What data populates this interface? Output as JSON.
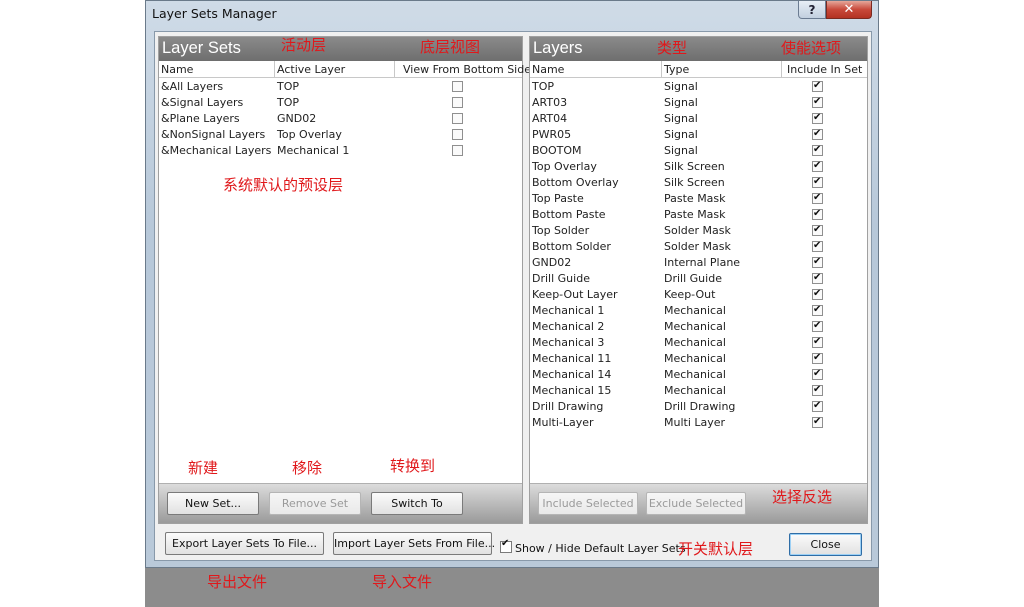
{
  "window": {
    "title": "Layer Sets Manager",
    "help": "?",
    "close": "✕"
  },
  "left": {
    "title": "Layer Sets",
    "columns": [
      "Name",
      "Active Layer",
      "View From Bottom Side"
    ],
    "rows": [
      {
        "name": "&All Layers",
        "active": "TOP",
        "bottom": false
      },
      {
        "name": "&Signal Layers",
        "active": "TOP",
        "bottom": false
      },
      {
        "name": "&Plane Layers",
        "active": "GND02",
        "bottom": false
      },
      {
        "name": "&NonSignal Layers",
        "active": "Top Overlay",
        "bottom": false
      },
      {
        "name": "&Mechanical Layers",
        "active": "Mechanical 1",
        "bottom": false
      }
    ],
    "buttons": {
      "new_set": "New Set...",
      "remove_set": "Remove Set",
      "switch_to": "Switch To"
    }
  },
  "right": {
    "title": "Layers",
    "columns": [
      "Name",
      "Type",
      "Include In Set"
    ],
    "rows": [
      {
        "name": "TOP",
        "type": "Signal",
        "include": true
      },
      {
        "name": "ART03",
        "type": "Signal",
        "include": true
      },
      {
        "name": "ART04",
        "type": "Signal",
        "include": true
      },
      {
        "name": "PWR05",
        "type": "Signal",
        "include": true
      },
      {
        "name": "BOOTOM",
        "type": "Signal",
        "include": true
      },
      {
        "name": "Top Overlay",
        "type": "Silk Screen",
        "include": true
      },
      {
        "name": "Bottom Overlay",
        "type": "Silk Screen",
        "include": true
      },
      {
        "name": "Top Paste",
        "type": "Paste Mask",
        "include": true
      },
      {
        "name": "Bottom Paste",
        "type": "Paste Mask",
        "include": true
      },
      {
        "name": "Top Solder",
        "type": "Solder Mask",
        "include": true
      },
      {
        "name": "Bottom Solder",
        "type": "Solder Mask",
        "include": true
      },
      {
        "name": "GND02",
        "type": "Internal Plane",
        "include": true
      },
      {
        "name": "Drill Guide",
        "type": "Drill Guide",
        "include": true
      },
      {
        "name": "Keep-Out Layer",
        "type": "Keep-Out",
        "include": true
      },
      {
        "name": "Mechanical 1",
        "type": "Mechanical",
        "include": true
      },
      {
        "name": "Mechanical 2",
        "type": "Mechanical",
        "include": true
      },
      {
        "name": "Mechanical 3",
        "type": "Mechanical",
        "include": true
      },
      {
        "name": "Mechanical 11",
        "type": "Mechanical",
        "include": true
      },
      {
        "name": "Mechanical 14",
        "type": "Mechanical",
        "include": true
      },
      {
        "name": "Mechanical 15",
        "type": "Mechanical",
        "include": true
      },
      {
        "name": "Drill Drawing",
        "type": "Drill Drawing",
        "include": true
      },
      {
        "name": "Multi-Layer",
        "type": "Multi Layer",
        "include": true
      }
    ],
    "buttons": {
      "include_selected": "Include Selected",
      "exclude_selected": "Exclude Selected"
    }
  },
  "bottom": {
    "export": "Export Layer Sets To File...",
    "import": "Import Layer Sets From File...",
    "show_hide": "Show / Hide Default Layer Sets",
    "show_hide_checked": true,
    "close": "Close"
  },
  "annotations": {
    "active_layer": "活动层",
    "bottom_view": "底层视图",
    "type": "类型",
    "enable_option": "使能选项",
    "default_sets": "系统默认的预设层",
    "new": "新建",
    "remove": "移除",
    "switch": "转换到",
    "invert_select": "选择反选",
    "toggle_default": "开关默认层",
    "export_file": "导出文件",
    "import_file": "导入文件"
  },
  "colors": {
    "annotation": "#e0181b",
    "panel_header": "#7a7a7a",
    "title_bar": "#c5d4e3"
  }
}
